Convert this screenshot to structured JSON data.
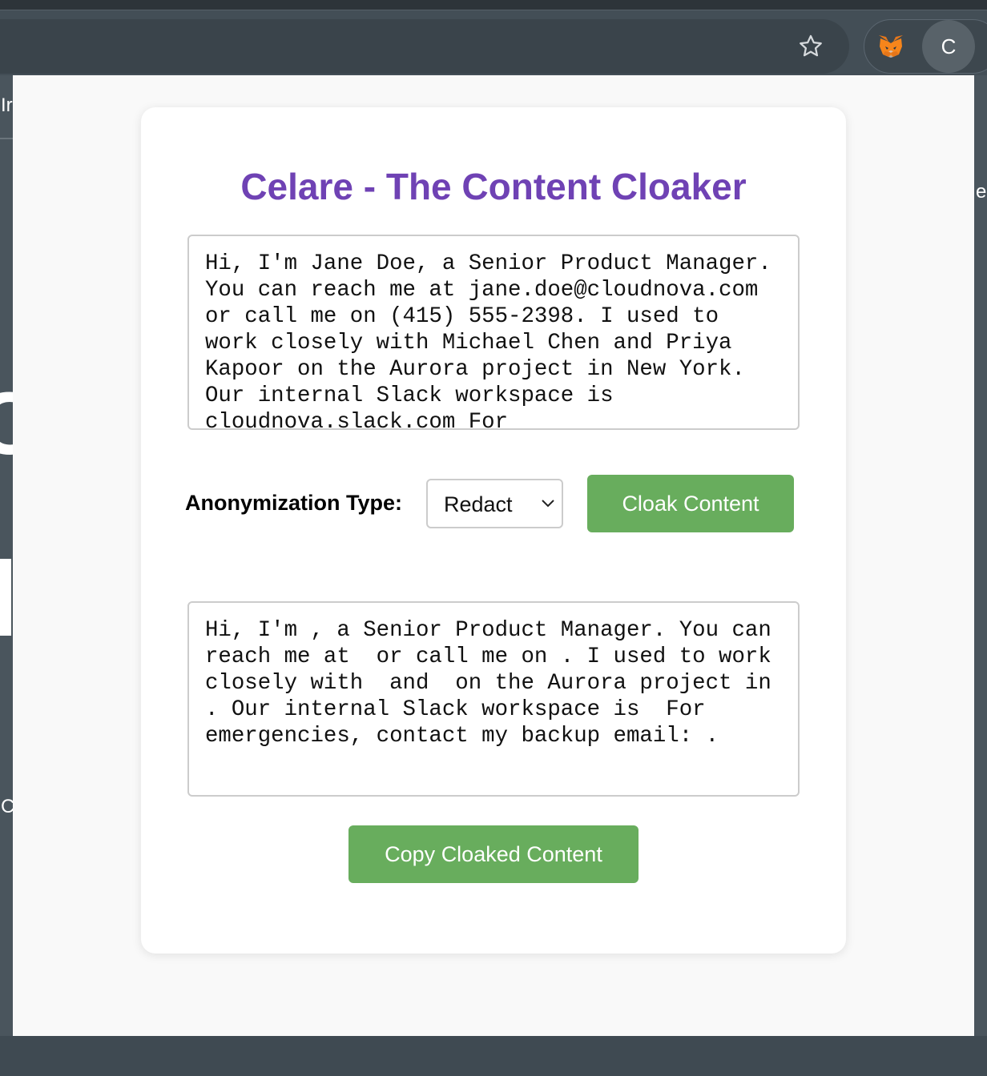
{
  "browser": {
    "icons": {
      "bookmark_star": "star-icon",
      "metamask": "fox-icon"
    },
    "profile_avatar_letter": "C"
  },
  "background_fragments": {
    "left_top": "Ir",
    "left_middle": "C",
    "left_bottom": "C",
    "right": "e"
  },
  "popup": {
    "title": "Celare - The Content Cloaker",
    "input_text": "Hi, I'm Jane Doe, a Senior Product Manager. You can reach me at jane.doe@cloudnova.com or call me on (415) 555-2398. I used to work closely with Michael Chen and Priya Kapoor on the Aurora project in New York. Our internal Slack workspace is cloudnova.slack.com For",
    "anonymization_label": "Anonymization Type:",
    "anonymization_selected": "Redact",
    "cloak_button_label": "Cloak Content",
    "output_text": "Hi, I'm , a Senior Product Manager. You can reach me at  or call me on . I used to work closely with  and  on the Aurora project in . Our internal Slack workspace is  For emergencies, contact my backup email: .",
    "copy_button_label": "Copy Cloaked Content"
  },
  "colors": {
    "title": "#6f42b4",
    "button_green": "#68ad5d",
    "card_background": "#ffffff",
    "chrome_toolbar": "#434e56"
  }
}
